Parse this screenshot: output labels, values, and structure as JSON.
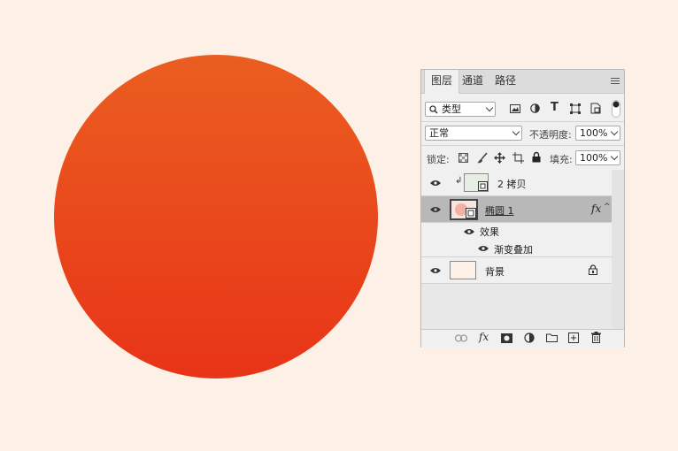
{
  "panel": {
    "tabs": [
      {
        "label": "图层",
        "active": true
      },
      {
        "label": "通道",
        "active": false
      },
      {
        "label": "路径",
        "active": false
      }
    ],
    "filter": {
      "label": "类型"
    },
    "blend_mode": {
      "value": "正常"
    },
    "opacity": {
      "label": "不透明度:",
      "value": "100%"
    },
    "lock": {
      "label": "锁定:"
    },
    "fill": {
      "label": "填充:",
      "value": "100%"
    },
    "layers": [
      {
        "name": "2 拷贝",
        "visible": true,
        "clipped": true,
        "selected": false
      },
      {
        "name": "椭圆 1",
        "visible": true,
        "selected": true,
        "fx": "fx",
        "effects_label": "效果",
        "effects": [
          "渐变叠加"
        ]
      },
      {
        "name": "背景",
        "visible": true,
        "locked": true,
        "selected": false
      }
    ]
  },
  "colors": {
    "canvas_background": "#fdf0e7",
    "circle_top": "#ea5e20",
    "circle_bottom": "#e83418",
    "selected_layer": "#b8b8b8"
  }
}
